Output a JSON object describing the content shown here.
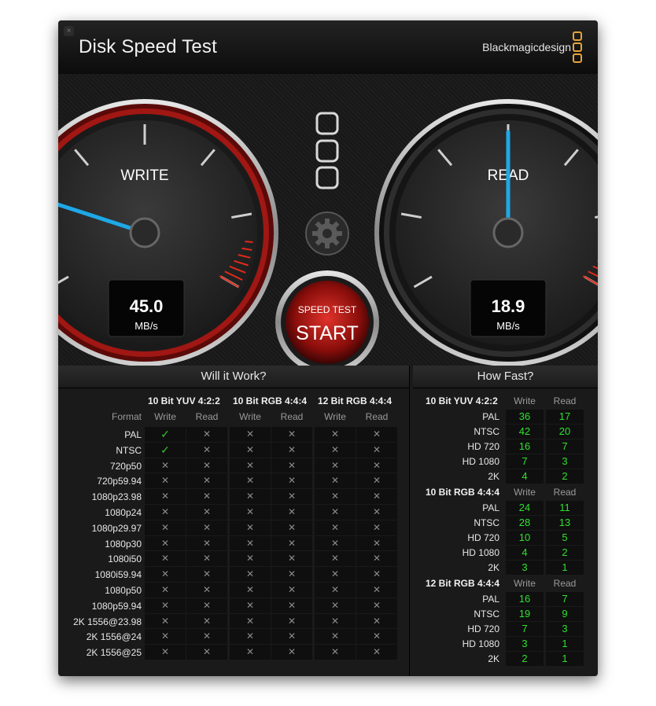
{
  "app": {
    "title": "Disk Speed Test",
    "brand": "Blackmagicdesign",
    "close_glyph": "×"
  },
  "gauges": {
    "write": {
      "label": "WRITE",
      "value": "45.0",
      "unit": "MB/s",
      "needle_fraction": 0.2,
      "accent": "#c0201c"
    },
    "read": {
      "label": "READ",
      "value": "18.9",
      "unit": "MB/s",
      "needle_fraction": 0.5,
      "accent": "#7a7a7a"
    },
    "needle_color": "#1ea8e8"
  },
  "controls": {
    "settings_icon": "gear-icon",
    "start_top": "SPEED TEST",
    "start_main": "START"
  },
  "will_it_work": {
    "title": "Will it Work?",
    "format_label": "Format",
    "groups": [
      "10 Bit YUV 4:2:2",
      "10 Bit RGB 4:4:4",
      "12 Bit RGB 4:4:4"
    ],
    "subcols": [
      "Write",
      "Read"
    ],
    "rows": [
      {
        "format": "PAL",
        "cells": [
          "✓",
          "✕",
          "✕",
          "✕",
          "✕",
          "✕"
        ]
      },
      {
        "format": "NTSC",
        "cells": [
          "✓",
          "✕",
          "✕",
          "✕",
          "✕",
          "✕"
        ]
      },
      {
        "format": "720p50",
        "cells": [
          "✕",
          "✕",
          "✕",
          "✕",
          "✕",
          "✕"
        ]
      },
      {
        "format": "720p59.94",
        "cells": [
          "✕",
          "✕",
          "✕",
          "✕",
          "✕",
          "✕"
        ]
      },
      {
        "format": "1080p23.98",
        "cells": [
          "✕",
          "✕",
          "✕",
          "✕",
          "✕",
          "✕"
        ]
      },
      {
        "format": "1080p24",
        "cells": [
          "✕",
          "✕",
          "✕",
          "✕",
          "✕",
          "✕"
        ]
      },
      {
        "format": "1080p29.97",
        "cells": [
          "✕",
          "✕",
          "✕",
          "✕",
          "✕",
          "✕"
        ]
      },
      {
        "format": "1080p30",
        "cells": [
          "✕",
          "✕",
          "✕",
          "✕",
          "✕",
          "✕"
        ]
      },
      {
        "format": "1080i50",
        "cells": [
          "✕",
          "✕",
          "✕",
          "✕",
          "✕",
          "✕"
        ]
      },
      {
        "format": "1080i59.94",
        "cells": [
          "✕",
          "✕",
          "✕",
          "✕",
          "✕",
          "✕"
        ]
      },
      {
        "format": "1080p50",
        "cells": [
          "✕",
          "✕",
          "✕",
          "✕",
          "✕",
          "✕"
        ]
      },
      {
        "format": "1080p59.94",
        "cells": [
          "✕",
          "✕",
          "✕",
          "✕",
          "✕",
          "✕"
        ]
      },
      {
        "format": "2K 1556@23.98",
        "cells": [
          "✕",
          "✕",
          "✕",
          "✕",
          "✕",
          "✕"
        ]
      },
      {
        "format": "2K 1556@24",
        "cells": [
          "✕",
          "✕",
          "✕",
          "✕",
          "✕",
          "✕"
        ]
      },
      {
        "format": "2K 1556@25",
        "cells": [
          "✕",
          "✕",
          "✕",
          "✕",
          "✕",
          "✕"
        ]
      }
    ]
  },
  "how_fast": {
    "title": "How Fast?",
    "subcols": [
      "Write",
      "Read"
    ],
    "groups": [
      {
        "name": "10 Bit YUV 4:2:2",
        "rows": [
          {
            "format": "PAL",
            "write": "36",
            "read": "17"
          },
          {
            "format": "NTSC",
            "write": "42",
            "read": "20"
          },
          {
            "format": "HD 720",
            "write": "16",
            "read": "7"
          },
          {
            "format": "HD 1080",
            "write": "7",
            "read": "3"
          },
          {
            "format": "2K",
            "write": "4",
            "read": "2"
          }
        ]
      },
      {
        "name": "10 Bit RGB 4:4:4",
        "rows": [
          {
            "format": "PAL",
            "write": "24",
            "read": "11"
          },
          {
            "format": "NTSC",
            "write": "28",
            "read": "13"
          },
          {
            "format": "HD 720",
            "write": "10",
            "read": "5"
          },
          {
            "format": "HD 1080",
            "write": "4",
            "read": "2"
          },
          {
            "format": "2K",
            "write": "3",
            "read": "1"
          }
        ]
      },
      {
        "name": "12 Bit RGB 4:4:4",
        "rows": [
          {
            "format": "PAL",
            "write": "16",
            "read": "7"
          },
          {
            "format": "NTSC",
            "write": "19",
            "read": "9"
          },
          {
            "format": "HD 720",
            "write": "7",
            "read": "3"
          },
          {
            "format": "HD 1080",
            "write": "3",
            "read": "1"
          },
          {
            "format": "2K",
            "write": "2",
            "read": "1"
          }
        ]
      }
    ]
  }
}
